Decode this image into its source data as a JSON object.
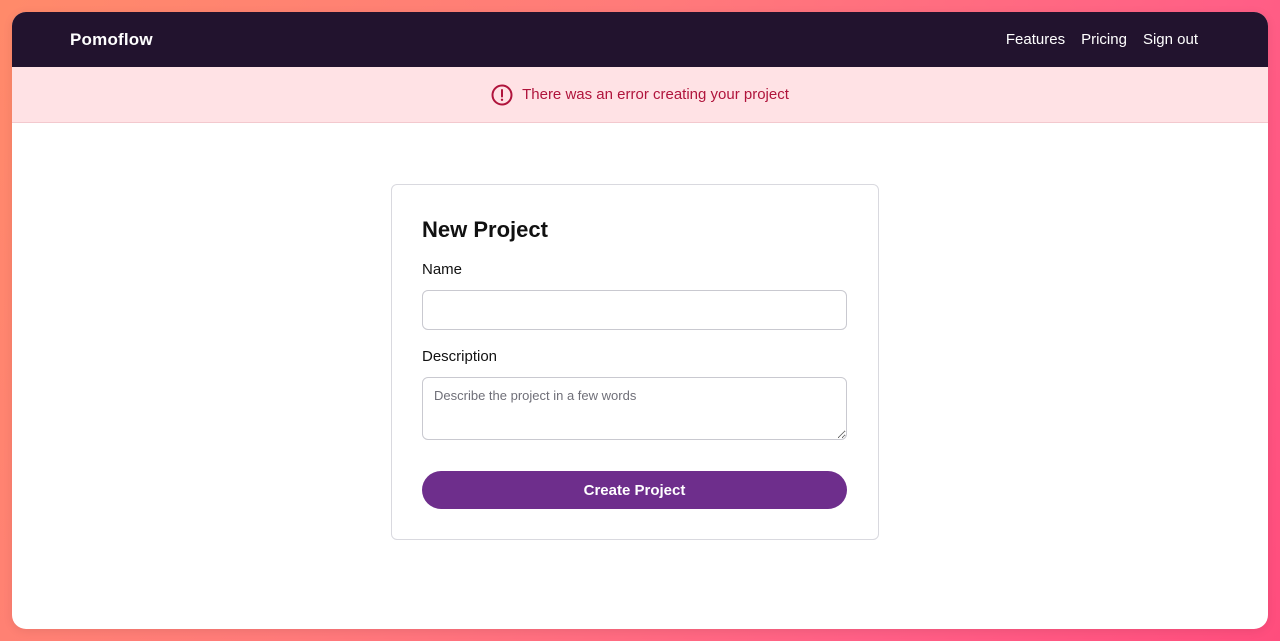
{
  "brand": {
    "name": "Pomoflow"
  },
  "nav": {
    "items": [
      {
        "label": "Features"
      },
      {
        "label": "Pricing"
      },
      {
        "label": "Sign out"
      }
    ]
  },
  "alert": {
    "message": "There was an error creating your project",
    "icon": "alert-circle-icon",
    "color": "#b0143c",
    "background": "#ffe2e5"
  },
  "form": {
    "title": "New Project",
    "name_label": "Name",
    "name_value": "",
    "description_label": "Description",
    "description_placeholder": "Describe the project in a few words",
    "submit_label": "Create Project"
  },
  "colors": {
    "navbar": "#22132e",
    "accent": "#6e2e8c"
  }
}
